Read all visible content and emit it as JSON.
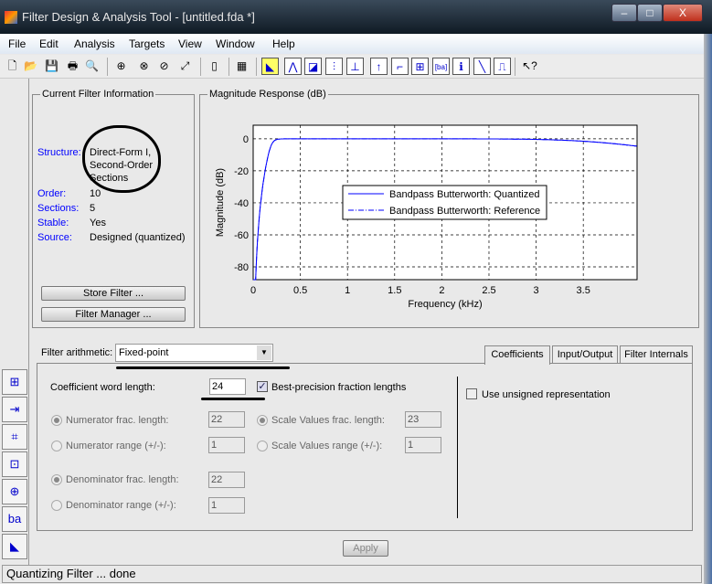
{
  "window": {
    "title": "Filter Design & Analysis Tool -  [untitled.fda *]",
    "min": "–",
    "max": "□",
    "close": "X"
  },
  "menu": [
    "File",
    "Edit",
    "Analysis",
    "Targets",
    "View",
    "Window",
    "Help"
  ],
  "toolbar": [
    {
      "name": "new-icon",
      "g": "🗋"
    },
    {
      "name": "open-icon",
      "g": "📂"
    },
    {
      "name": "save-icon",
      "g": "💾"
    },
    {
      "name": "print-icon",
      "g": "🖶"
    },
    {
      "name": "print-preview-icon",
      "g": "🔍"
    },
    {
      "name": "zoom-in-icon",
      "g": "⊕"
    },
    {
      "name": "zoom-x-icon",
      "g": "⊗"
    },
    {
      "name": "zoom-y-icon",
      "g": "⊘"
    },
    {
      "name": "full-view-icon",
      "g": "⤢"
    },
    {
      "name": "new-session-icon",
      "g": "▯"
    },
    {
      "name": "filter-gray-icon",
      "g": "▦"
    },
    {
      "name": "magnitude-response-icon",
      "g": "◣"
    },
    {
      "name": "phase-response-icon",
      "g": "⋀"
    },
    {
      "name": "mag-phase-icon",
      "g": "◪"
    },
    {
      "name": "group-delay-icon",
      "g": "⫶"
    },
    {
      "name": "phase-delay-icon",
      "g": "⊥"
    },
    {
      "name": "impulse-response-icon",
      "g": "↑"
    },
    {
      "name": "step-response-icon",
      "g": "⌐"
    },
    {
      "name": "pole-zero-icon",
      "g": "⊞"
    },
    {
      "name": "coefficients-icon",
      "g": "[ba]"
    },
    {
      "name": "info-icon",
      "g": "ℹ"
    },
    {
      "name": "magnitude-estimate-icon",
      "g": "╲"
    },
    {
      "name": "noise-power-icon",
      "g": "⎍"
    },
    {
      "name": "whats-this-icon",
      "g": "↖?"
    }
  ],
  "info": {
    "legend": "Current Filter Information",
    "rows": [
      {
        "label": "Structure:",
        "value": "Direct-Form I,"
      },
      {
        "label": "",
        "value": "Second-Order"
      },
      {
        "label": "",
        "value": "Sections"
      },
      {
        "label": "Order:",
        "value": "10"
      },
      {
        "label": "Sections:",
        "value": "5"
      },
      {
        "label": "Stable:",
        "value": "Yes"
      },
      {
        "label": "Source:",
        "value": "Designed (quantized)"
      }
    ],
    "store": "Store Filter ...",
    "manager": "Filter Manager ..."
  },
  "chart_data": {
    "type": "line",
    "title": "Magnitude Response (dB)",
    "xlabel": "Frequency (kHz)",
    "ylabel": "Magnitude (dB)",
    "xlim": [
      0,
      4.07
    ],
    "ylim": [
      -88,
      8.5
    ],
    "xticks": [
      0,
      0.5,
      1,
      1.5,
      2,
      2.5,
      3,
      3.5
    ],
    "yticks": [
      0,
      -20,
      -40,
      -60,
      -80
    ],
    "grid": true,
    "legend_position": "center",
    "series": [
      {
        "name": "Bandpass Butterworth: Quantized",
        "style": "solid",
        "color": "#0000ff"
      },
      {
        "name": "Bandpass Butterworth: Reference",
        "style": "dashdot",
        "color": "#0000ff"
      }
    ],
    "band": {
      "f1": 0.2,
      "f2": 3.82,
      "order": 5
    }
  },
  "arith": {
    "label": "Filter arithmetic:",
    "value": "Fixed-point"
  },
  "tabs": [
    "Coefficients",
    "Input/Output",
    "Filter Internals"
  ],
  "coef": {
    "wl_label": "Coefficient word length:",
    "wl": "24",
    "best": "Best-precision fraction lengths",
    "num_frac": "Numerator frac. length:",
    "num_frac_v": "22",
    "num_range": "Numerator range (+/-):",
    "num_range_v": "1",
    "den_frac": "Denominator frac. length:",
    "den_frac_v": "22",
    "den_range": "Denominator range (+/-):",
    "den_range_v": "1",
    "sv_frac": "Scale Values frac. length:",
    "sv_frac_v": "23",
    "sv_range": "Scale Values range (+/-):",
    "sv_range_v": "1",
    "unsigned": "Use unsigned representation"
  },
  "apply": "Apply",
  "left_tools": [
    {
      "name": "transform-filter-icon",
      "g": "⊞"
    },
    {
      "name": "sample-rate-icon",
      "g": "⇥"
    },
    {
      "name": "quantize-icon",
      "g": "⌗"
    },
    {
      "name": "realize-model-icon",
      "g": "⊡"
    },
    {
      "name": "pole-zero-editor-icon",
      "g": "⊕"
    },
    {
      "name": "import-filter-icon",
      "g": "ba"
    },
    {
      "name": "design-filter-icon",
      "g": "◣"
    }
  ],
  "status": "Quantizing Filter ... done"
}
